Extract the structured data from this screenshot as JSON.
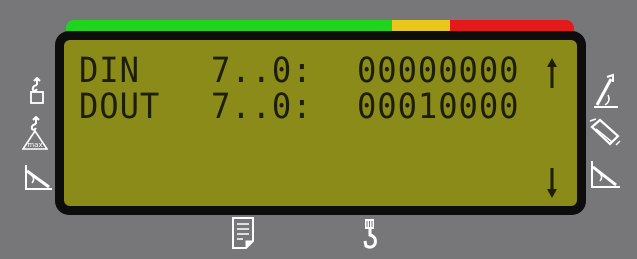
{
  "colors": {
    "background": "#777779",
    "bezel": "#0d0d0d",
    "lcd": "#8b8b19",
    "lcd_text": "#1e1e08",
    "load_green": "#1fd31f",
    "load_yellow": "#e8c81a",
    "load_red": "#e41a1a",
    "icon": "#ffffff"
  },
  "load_indicator": {
    "segments": [
      "green",
      "yellow",
      "red"
    ]
  },
  "display": {
    "rows": [
      {
        "label": "DIN",
        "range": "7..0:",
        "value": "00000000"
      },
      {
        "label": "DOUT",
        "range": "7..0:",
        "value": "00010000"
      }
    ],
    "scroll_up_icon": "arrow-up-icon",
    "scroll_down_icon": "arrow-down-icon"
  },
  "left_icons": [
    "hook-load-icon",
    "max-load-triangle-icon",
    "boom-angle-icon"
  ],
  "right_icons": [
    "boom-raise-icon",
    "boom-extend-icon",
    "boom-lower-icon"
  ],
  "bottom_icons": [
    "report-document-icon",
    "crane-hook-icon"
  ],
  "max_label": "max"
}
